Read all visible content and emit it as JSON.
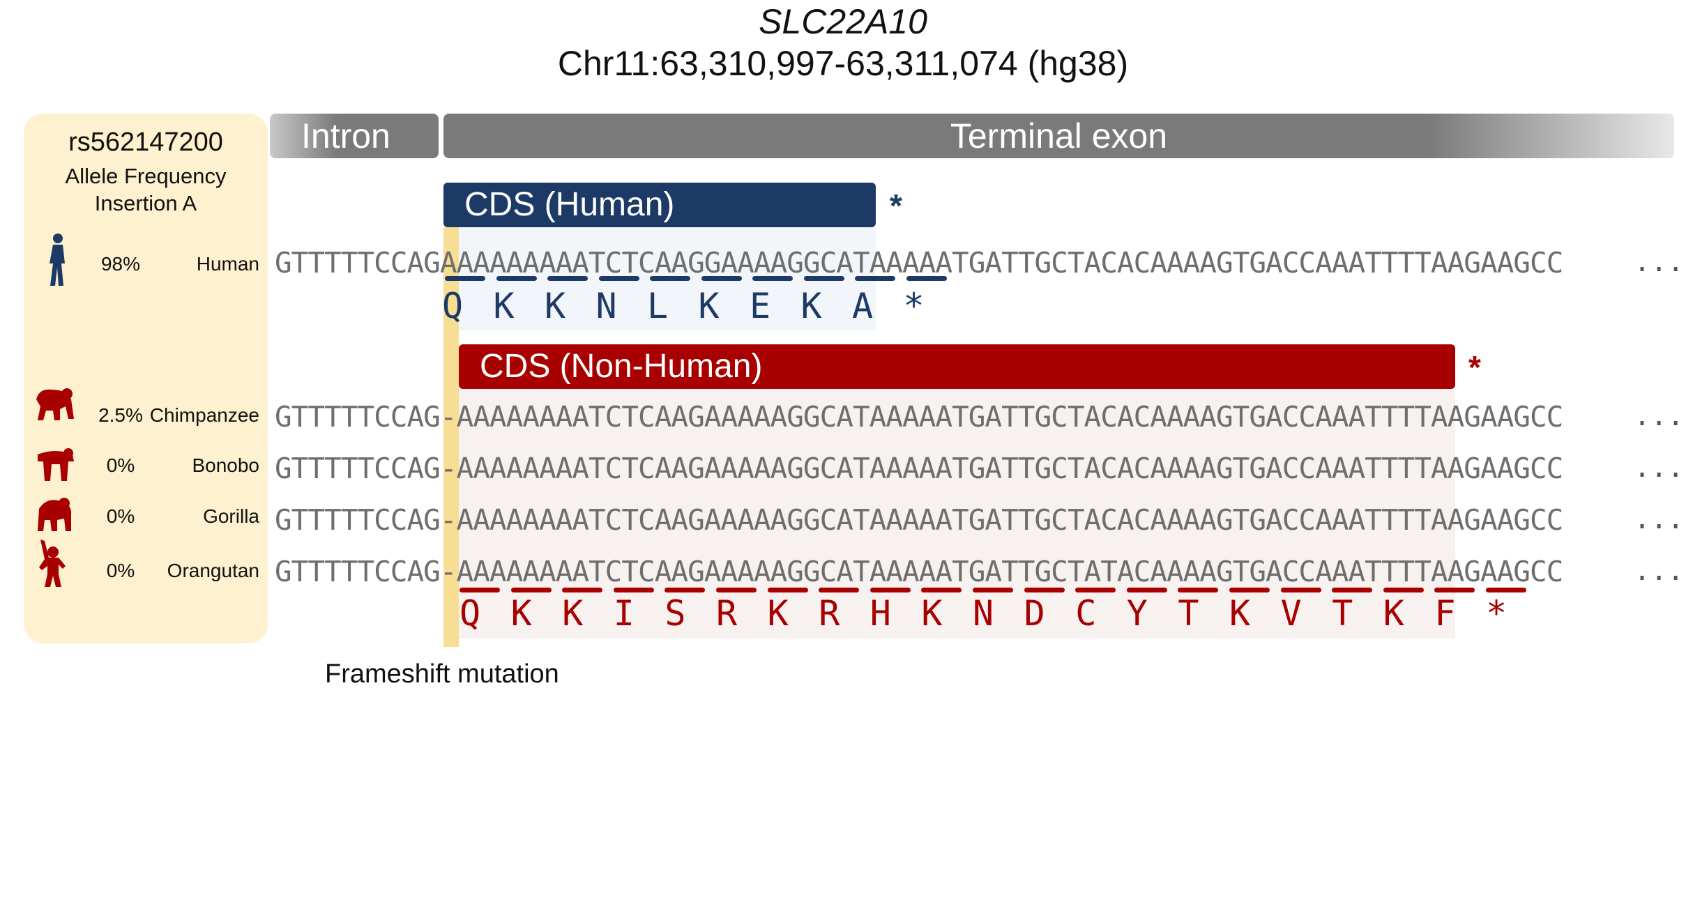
{
  "header": {
    "gene": "SLC22A10",
    "coordinates": "Chr11:63,310,997-63,311,074 (hg38)"
  },
  "panel": {
    "snp_id": "rs562147200",
    "line2": "Allele Frequency",
    "line3": "Insertion A"
  },
  "regions": {
    "intron": "Intron",
    "exon": "Terminal exon"
  },
  "cds": {
    "human": "CDS (Human)",
    "nonhuman": "CDS (Non-Human)",
    "stop_symbol": "*"
  },
  "species": [
    {
      "name": "Human",
      "freq": "98%",
      "sequence": "GTTTTTCCAGAAAAAAAAATCTCAAGGAAAAGGCATAAAAATGATTGCTACACAAAAGTGACCAAATTTTAAGAAGCC",
      "color": "#1d3a66"
    },
    {
      "name": "Chimpanzee",
      "freq": "2.5%",
      "sequence": "GTTTTTCCAG-AAAAAAAATCTCAAGAAAAAGGCATAAAAATGATTGCTACACAAAAGTGACCAAATTTTAAGAAGCC",
      "color": "#a80000"
    },
    {
      "name": "Bonobo",
      "freq": "0%",
      "sequence": "GTTTTTCCAG-AAAAAAAATCTCAAGAAAAAGGCATAAAAATGATTGCTACACAAAAGTGACCAAATTTTAAGAAGCC",
      "color": "#a80000"
    },
    {
      "name": "Gorilla",
      "freq": "0%",
      "sequence": "GTTTTTCCAG-AAAAAAAATCTCAAGAAAAAGGCATAAAAATGATTGCTACACAAAAGTGACCAAATTTTAAGAAGCC",
      "color": "#a80000"
    },
    {
      "name": "Orangutan",
      "freq": "0%",
      "sequence": "GTTTTTCCAG-AAAAAAAATCTCAAGAAAAAGGCATAAAAATGATTGCTATACAAAAGTGACCAAATTTTAAGAAGCC",
      "color": "#a80000"
    }
  ],
  "ellipsis": "...",
  "human_protein": [
    "Q",
    "K",
    "K",
    "N",
    "L",
    "K",
    "E",
    "K",
    "A",
    "*"
  ],
  "nonhuman_protein": [
    "Q",
    "K",
    "K",
    "I",
    "S",
    "R",
    "K",
    "R",
    "H",
    "K",
    "N",
    "D",
    "C",
    "Y",
    "T",
    "K",
    "V",
    "T",
    "K",
    "F",
    "*"
  ],
  "caption": "Frameshift mutation",
  "colors": {
    "human": "#1d3a66",
    "nonhuman": "#a80000",
    "panel": "#fdf1cf",
    "frameshift": "#f8dd95"
  }
}
